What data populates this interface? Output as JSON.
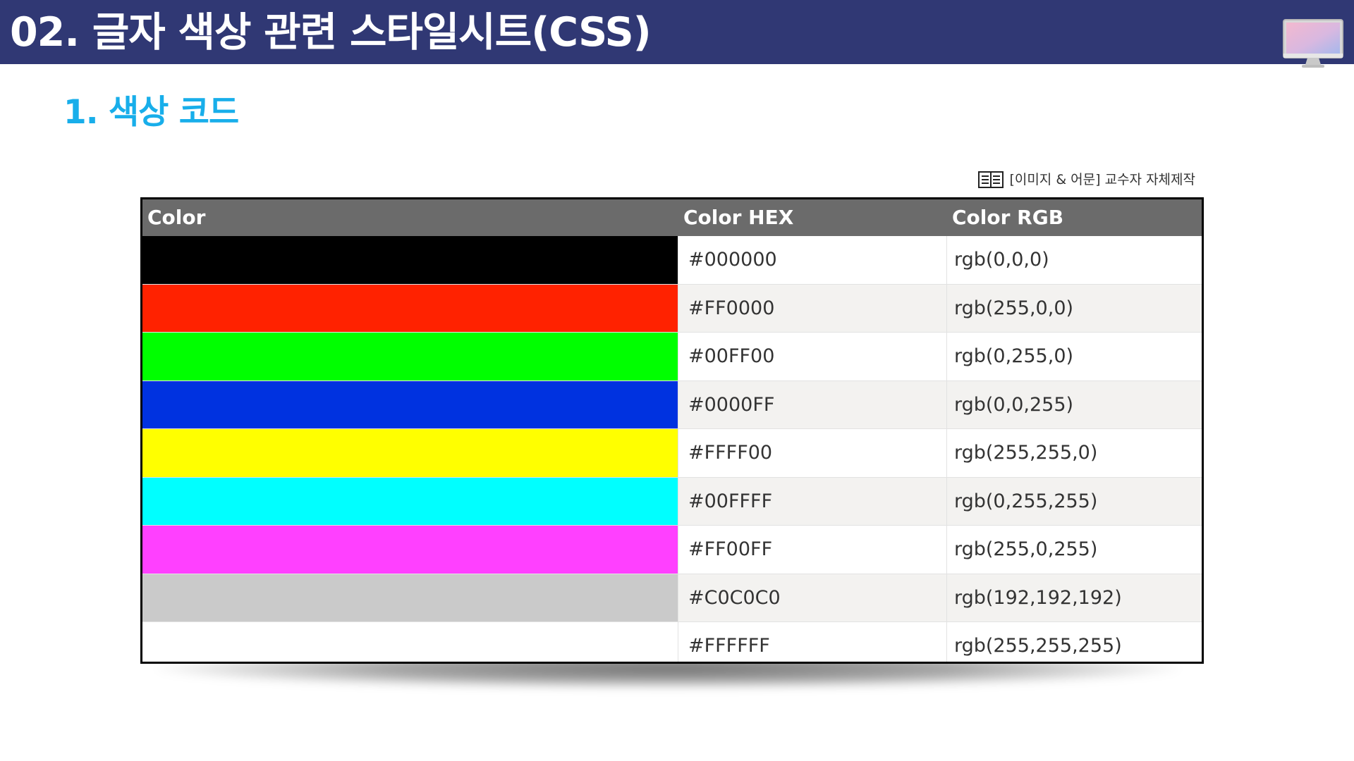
{
  "header": {
    "title": "02. 글자 색상 관련 스타일시트(CSS)",
    "bar_color": "#303874",
    "icon": "monitor-icon"
  },
  "section": {
    "heading": "1. 색상 코드",
    "heading_color": "#18aeea"
  },
  "caption": {
    "icon": "book-icon",
    "text": "[이미지 & 어문] 교수자 자체제작"
  },
  "table": {
    "headers": [
      "Color",
      "Color HEX",
      "Color RGB"
    ],
    "rows": [
      {
        "swatch": "#000000",
        "hex": "#000000",
        "rgb": "rgb(0,0,0)"
      },
      {
        "swatch": "#FF2200",
        "hex": "#FF0000",
        "rgb": "rgb(255,0,0)"
      },
      {
        "swatch": "#00FF00",
        "hex": "#00FF00",
        "rgb": "rgb(0,255,0)"
      },
      {
        "swatch": "#0032E0",
        "hex": "#0000FF",
        "rgb": "rgb(0,0,255)"
      },
      {
        "swatch": "#FFFF00",
        "hex": "#FFFF00",
        "rgb": "rgb(255,255,0)"
      },
      {
        "swatch": "#00FFFF",
        "hex": "#00FFFF",
        "rgb": "rgb(0,255,255)"
      },
      {
        "swatch": "#FF40FF",
        "hex": "#FF00FF",
        "rgb": "rgb(255,0,255)"
      },
      {
        "swatch": "#CACACA",
        "hex": "#C0C0C0",
        "rgb": "rgb(192,192,192)"
      },
      {
        "swatch": "#FFFFFF",
        "hex": "#FFFFFF",
        "rgb": "rgb(255,255,255)"
      }
    ]
  }
}
